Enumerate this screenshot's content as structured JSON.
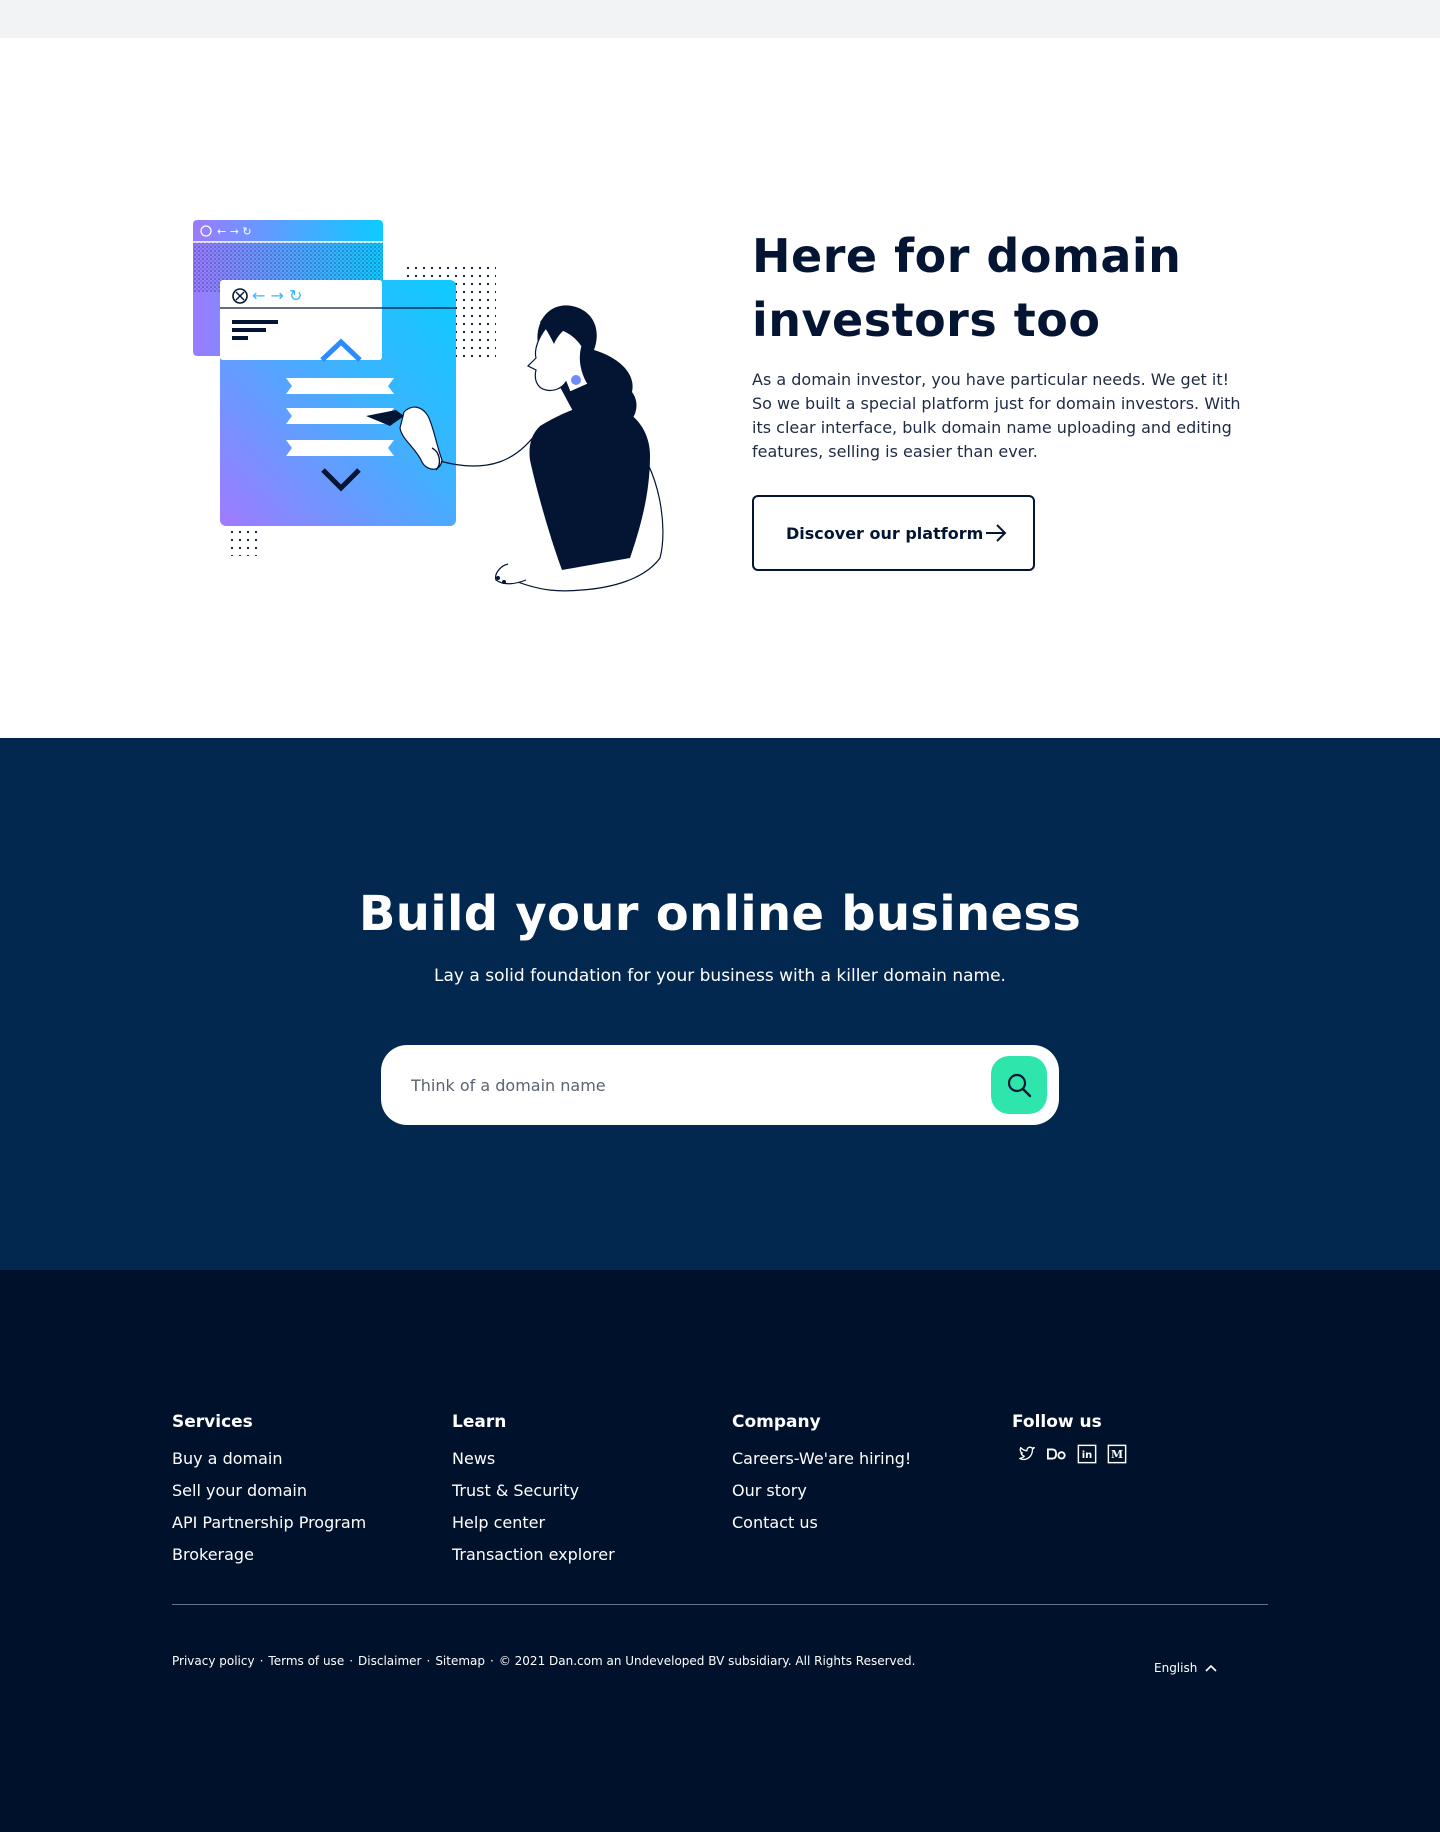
{
  "investors": {
    "title_line1": "Here for domain",
    "title_line2": "investors too",
    "description": "As a domain investor, you have particular needs. We get it! So we built a special platform just for domain investors. With its clear interface, bulk domain name uploading and editing features, selling is easier than ever.",
    "button_label": "Discover our platform"
  },
  "build": {
    "title": "Build your online business",
    "subtitle": "Lay a solid foundation for your business with a killer domain name.",
    "search_placeholder": "Think of a domain name"
  },
  "footer": {
    "services": {
      "heading": "Services",
      "links": [
        "Buy a domain",
        "Sell your domain",
        "API Partnership Program",
        "Brokerage"
      ]
    },
    "learn": {
      "heading": "Learn",
      "links": [
        "News",
        "Trust & Security",
        "Help center",
        "Transaction explorer"
      ]
    },
    "company": {
      "heading": "Company",
      "links": [
        "Careers-We'are hiring!",
        "Our story",
        "Contact us"
      ]
    },
    "follow": {
      "heading": "Follow us",
      "icons": [
        "twitter-icon",
        "dribbble-icon",
        "linkedin-icon",
        "medium-icon"
      ],
      "medium_letter": "M",
      "linkedin_letters": "in"
    },
    "legal": {
      "privacy": "Privacy policy",
      "terms": "Terms of use",
      "disclaimer": "Disclaimer",
      "sitemap": "Sitemap",
      "copyright": "© 2021 Dan.com an Undeveloped BV subsidiary. All Rights Reserved.",
      "separator": "·"
    },
    "language": "English"
  },
  "colors": {
    "navy": "#041534",
    "build_bg": "#03284f",
    "footer_bg": "#00112b",
    "accent_green": "#2ee6ac",
    "gradient_purple": "#9b7bff",
    "gradient_cyan": "#0ccbff"
  }
}
